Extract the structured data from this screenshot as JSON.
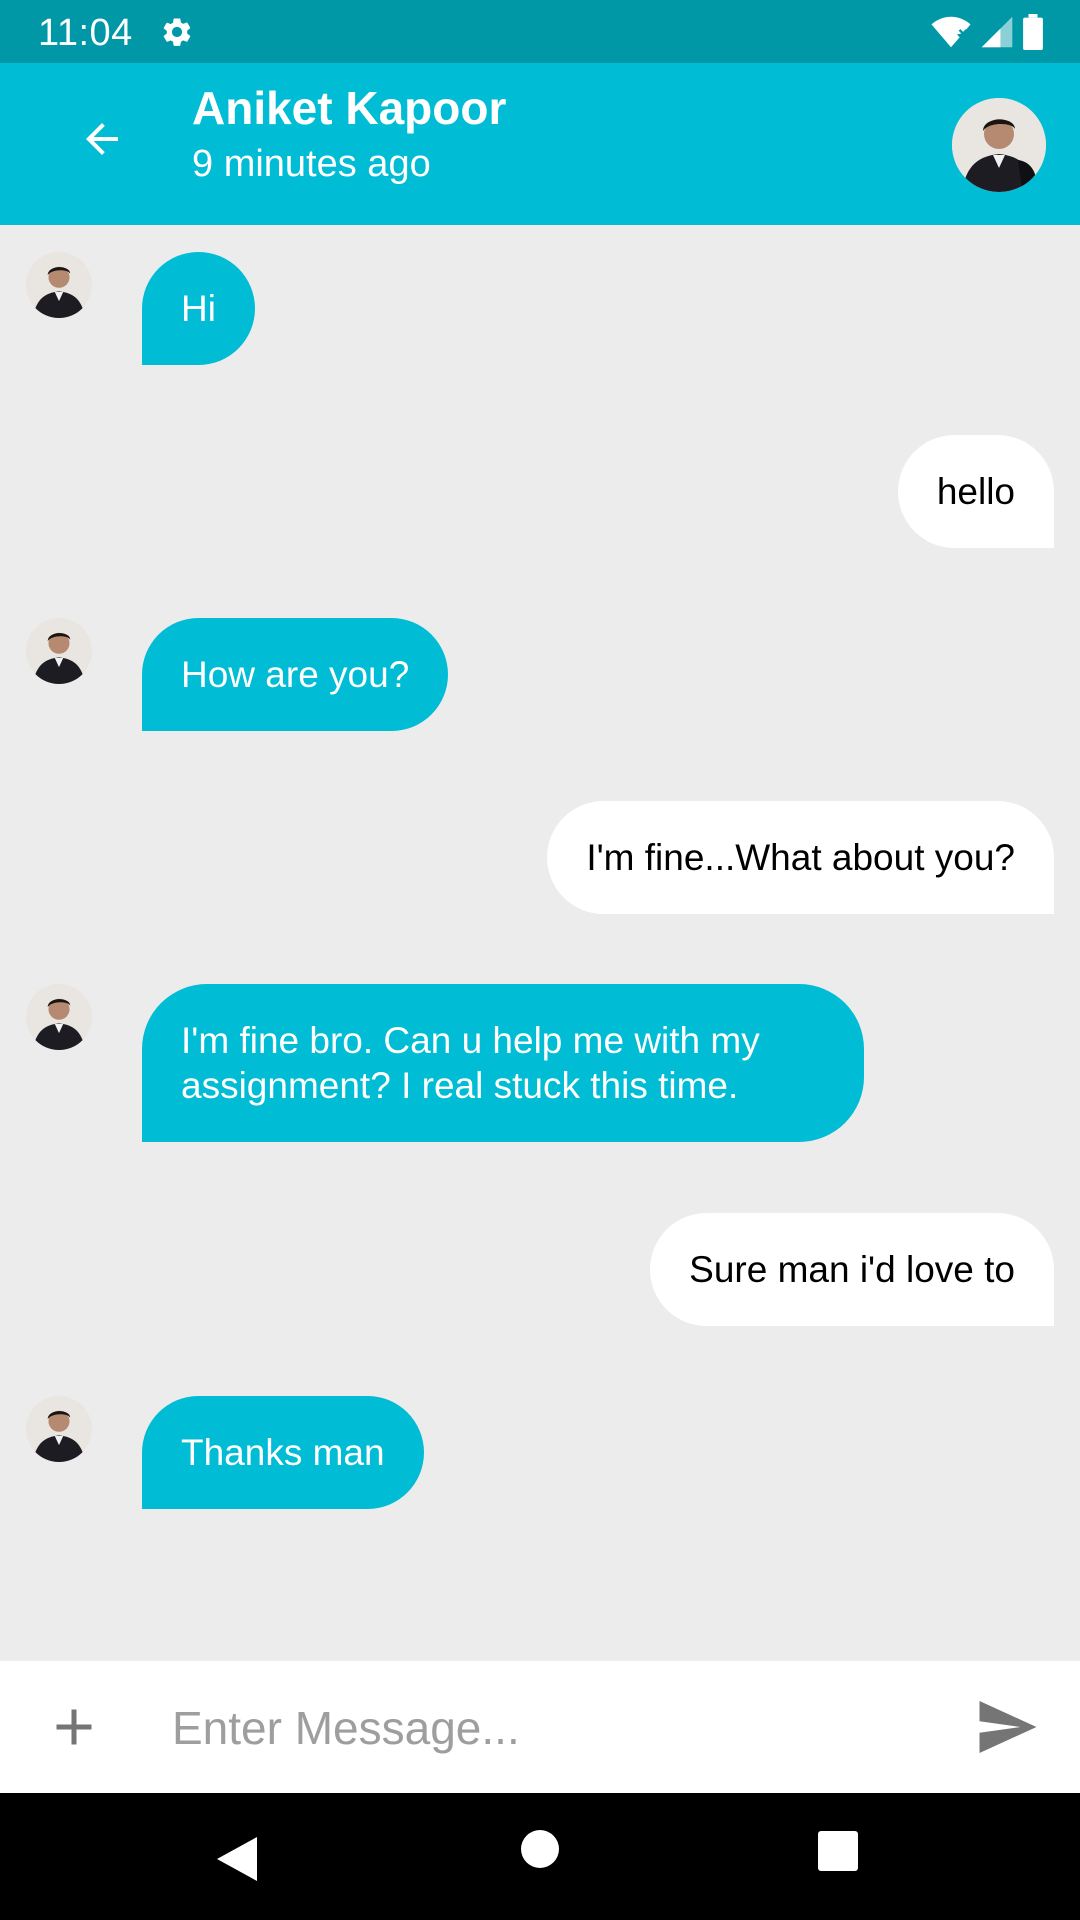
{
  "status_bar": {
    "time": "11:04"
  },
  "header": {
    "contact_name": "Aniket Kapoor",
    "last_seen": "9 minutes ago"
  },
  "messages": [
    {
      "direction": "incoming",
      "text": "Hi"
    },
    {
      "direction": "outgoing",
      "text": "hello"
    },
    {
      "direction": "incoming",
      "text": "How are you?"
    },
    {
      "direction": "outgoing",
      "text": "I'm fine...What about you?"
    },
    {
      "direction": "incoming",
      "text": "I'm fine bro. Can u help me with my assignment? I real stuck this time."
    },
    {
      "direction": "outgoing",
      "text": "Sure man i'd love to"
    },
    {
      "direction": "incoming",
      "text": "Thanks man"
    }
  ],
  "composer": {
    "placeholder": "Enter Message..."
  },
  "colors": {
    "primary": "#00bcd4",
    "primary_dark": "#0097a7",
    "background": "#ececec",
    "outgoing_bubble": "#ffffff"
  },
  "icons": {
    "back": "arrow-left-icon",
    "add": "plus-icon",
    "send": "send-icon",
    "settings": "gear-icon"
  }
}
